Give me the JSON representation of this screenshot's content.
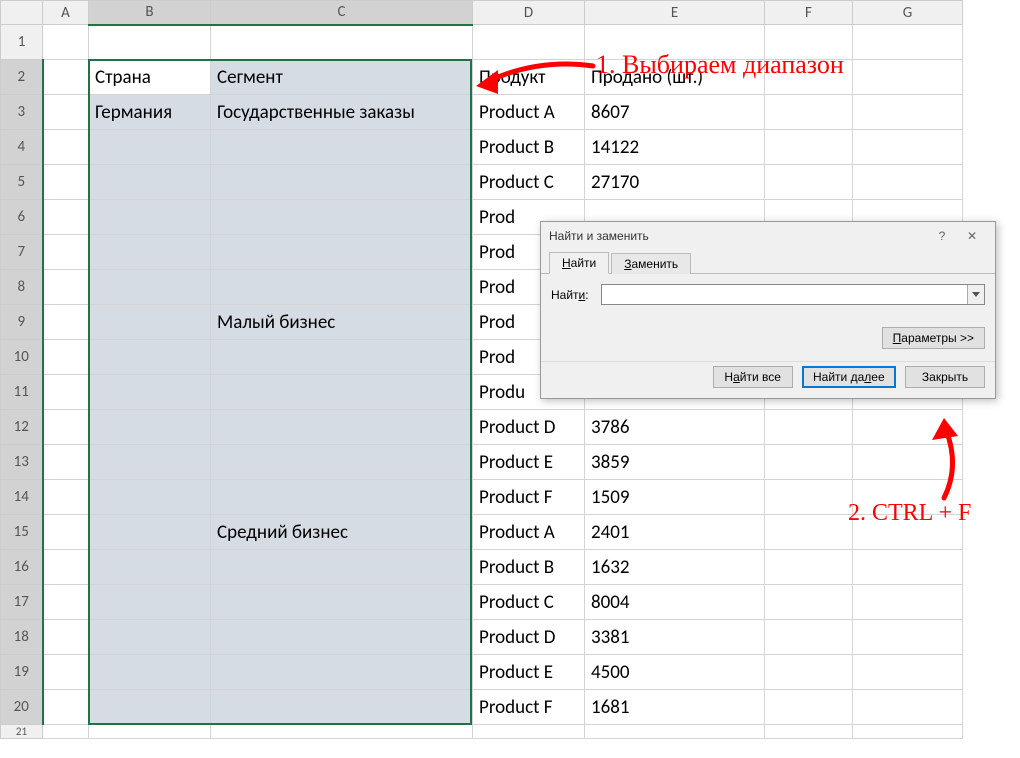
{
  "columns": [
    "A",
    "B",
    "C",
    "D",
    "E",
    "F",
    "G"
  ],
  "selected_cols": [
    "B",
    "C"
  ],
  "row_count": 20,
  "selected_rows_from": 2,
  "selected_rows_to": 20,
  "headers": {
    "b2": "Страна",
    "c2": "Сегмент",
    "d2": "Продукт",
    "e2": "Продано (шт.)"
  },
  "rows": [
    {
      "b": "Германия",
      "c": "Государственные заказы",
      "d": "Product A",
      "e": "8607"
    },
    {
      "b": "",
      "c": "",
      "d": "Product B",
      "e": "14122"
    },
    {
      "b": "",
      "c": "",
      "d": "Product C",
      "e": "27170"
    },
    {
      "b": "",
      "c": "",
      "d": "Prod",
      "e": ""
    },
    {
      "b": "",
      "c": "",
      "d": "Prod",
      "e": ""
    },
    {
      "b": "",
      "c": "",
      "d": "Prod",
      "e": ""
    },
    {
      "b": "",
      "c": "Малый бизнес",
      "d": "Prod",
      "e": ""
    },
    {
      "b": "",
      "c": "",
      "d": "Prod",
      "e": ""
    },
    {
      "b": "",
      "c": "",
      "d": "Produ",
      "e": ""
    },
    {
      "b": "",
      "c": "",
      "d": "Product D",
      "e": "3786"
    },
    {
      "b": "",
      "c": "",
      "d": "Product E",
      "e": "3859"
    },
    {
      "b": "",
      "c": "",
      "d": "Product F",
      "e": "1509"
    },
    {
      "b": "",
      "c": "Средний бизнес",
      "d": "Product A",
      "e": "2401"
    },
    {
      "b": "",
      "c": "",
      "d": "Product B",
      "e": "1632"
    },
    {
      "b": "",
      "c": "",
      "d": "Product C",
      "e": "8004"
    },
    {
      "b": "",
      "c": "",
      "d": "Product D",
      "e": "3381"
    },
    {
      "b": "",
      "c": "",
      "d": "Product E",
      "e": "4500"
    },
    {
      "b": "",
      "c": "",
      "d": "Product F",
      "e": "1681"
    }
  ],
  "dialog": {
    "title": "Найти и заменить",
    "help": "?",
    "close": "✕",
    "tab_find": "Найти",
    "tab_replace": "Заменить",
    "find_label": "Найти:",
    "find_value": "",
    "params_btn": "Параметры >>",
    "find_all_btn": "Найти все",
    "find_next_btn": "Найти далее",
    "close_btn": "Закрыть"
  },
  "annotations": {
    "step1": "1. Выбираем диапазон",
    "step2": "2. CTRL + F"
  }
}
